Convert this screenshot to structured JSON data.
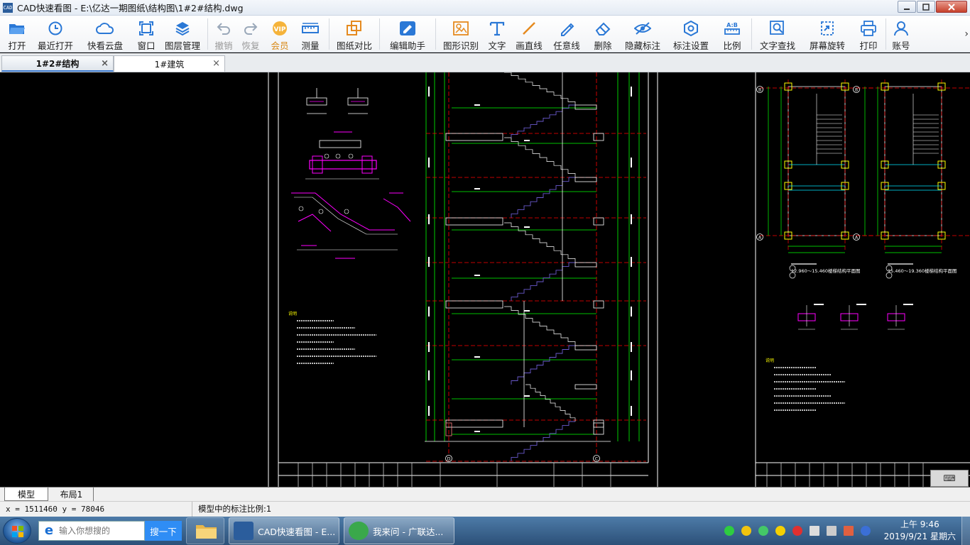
{
  "window": {
    "app_icon": "CAD",
    "title": "CAD快速看图 - E:\\亿达一期图纸\\结构图\\1#2#结构.dwg"
  },
  "toolbar": [
    {
      "id": "open",
      "label": "打开",
      "icon": "folder-open-icon"
    },
    {
      "id": "recent",
      "label": "最近打开",
      "icon": "clock-icon"
    },
    {
      "id": "cloud",
      "label": "快看云盘",
      "icon": "cloud-icon"
    },
    {
      "id": "window",
      "label": "窗口",
      "icon": "window-icon"
    },
    {
      "id": "layers",
      "label": "图层管理",
      "icon": "layers-icon"
    },
    {
      "id": "undo",
      "label": "撤销",
      "icon": "undo-icon"
    },
    {
      "id": "redo",
      "label": "恢复",
      "icon": "redo-icon"
    },
    {
      "id": "vip",
      "label": "会员",
      "icon": "vip-icon"
    },
    {
      "id": "measure",
      "label": "测量",
      "icon": "ruler-icon"
    },
    {
      "id": "compare",
      "label": "图纸对比",
      "icon": "compare-icon"
    },
    {
      "id": "edit",
      "label": "编辑助手",
      "icon": "edit-helper-icon"
    },
    {
      "id": "recognize",
      "label": "图形识别",
      "icon": "shape-recognize-icon"
    },
    {
      "id": "text",
      "label": "文字",
      "icon": "text-icon"
    },
    {
      "id": "line",
      "label": "画直线",
      "icon": "line-icon"
    },
    {
      "id": "freeline",
      "label": "任意线",
      "icon": "pencil-icon"
    },
    {
      "id": "delete",
      "label": "删除",
      "icon": "eraser-icon"
    },
    {
      "id": "hide",
      "label": "隐藏标注",
      "icon": "eye-hidden-icon"
    },
    {
      "id": "annot",
      "label": "标注设置",
      "icon": "annotation-settings-icon"
    },
    {
      "id": "scale",
      "label": "比例",
      "icon": "scale-icon"
    },
    {
      "id": "find",
      "label": "文字查找",
      "icon": "text-search-icon"
    },
    {
      "id": "rotate",
      "label": "屏幕旋转",
      "icon": "rotate-screen-icon"
    },
    {
      "id": "print",
      "label": "打印",
      "icon": "printer-icon"
    },
    {
      "id": "account",
      "label": "账号",
      "icon": "user-icon"
    }
  ],
  "toolbar_more": "›",
  "tabs": [
    {
      "label": "1#2#结构",
      "close": "×"
    },
    {
      "label": "1#建筑",
      "close": "×"
    }
  ],
  "drawing": {
    "axis_labels": [
      "B",
      "A",
      "B",
      "A",
      "D",
      "C"
    ],
    "section_titles": [
      "12.960～15.460楼梯结构平面图",
      "15.460～19.360楼梯结构平面图"
    ],
    "notes_heading": "说明"
  },
  "keyboard_toggle": "⌨",
  "layout_tabs": [
    "模型",
    "布局1"
  ],
  "status": {
    "coordinates": "x = 1511460  y = 78046",
    "scale_text": "模型中的标注比例:1"
  },
  "taskbar": {
    "search_placeholder": "输入你想搜的",
    "search_button": "搜一下",
    "tasks": [
      "CAD快速看图 - E...",
      "我来问 - 广联达..."
    ],
    "clock_time": "上午 9:46",
    "clock_date": "2019/9/21 星期六"
  },
  "colors": {
    "cad_background": "#000000",
    "cad_frame": "#ffffff",
    "cad_dim": "#00ff00",
    "cad_axis": "#ff0000",
    "cad_stair": "#6a5acd",
    "cad_magenta": "#ff00ff",
    "cad_yellow": "#ffff00",
    "accent_blue": "#2f8df5"
  }
}
